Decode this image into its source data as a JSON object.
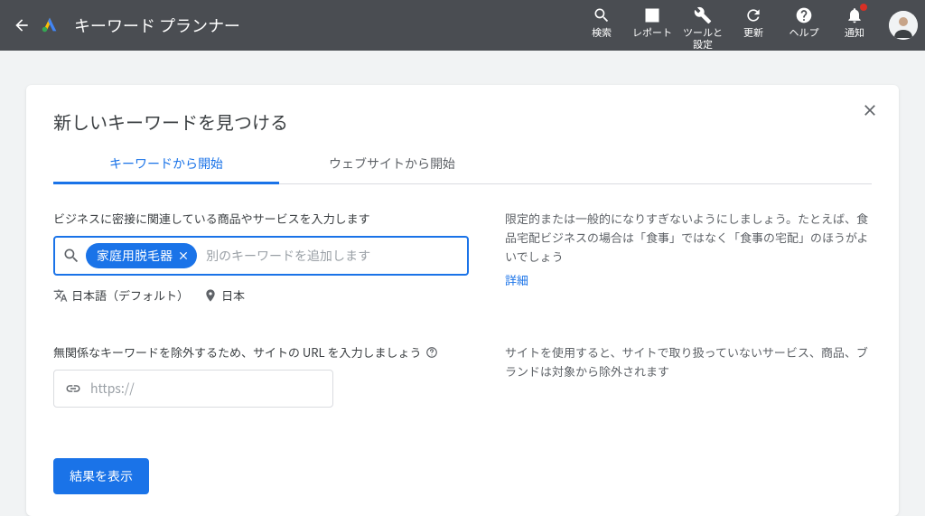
{
  "header": {
    "app_title": "キーワード プランナー",
    "tools": {
      "search": "検索",
      "reports": "レポート",
      "tools_settings": "ツールと\n設定",
      "refresh": "更新",
      "help": "ヘルプ",
      "notifications": "通知"
    }
  },
  "card": {
    "heading": "新しいキーワードを見つける",
    "tabs": {
      "by_keyword": "キーワードから開始",
      "by_website": "ウェブサイトから開始"
    },
    "field1_label": "ビジネスに密接に関連している商品やサービスを入力します",
    "chip1": "家庭用脱毛器",
    "kw_placeholder": "別のキーワードを追加します",
    "tip1": "限定的または一般的になりすぎないようにしましょう。たとえば、食品宅配ビジネスの場合は「食事」ではなく「食事の宅配」のほうがよいでしょう",
    "tip1_link": "詳細",
    "meta_language": "日本語（デフォルト）",
    "meta_location": "日本",
    "field2_label": "無関係なキーワードを除外するため、サイトの URL を入力しましょう",
    "url_value": "https://",
    "tip2": "サイトを使用すると、サイトで取り扱っていないサービス、商品、ブランドは対象から除外されます",
    "submit": "結果を表示"
  }
}
